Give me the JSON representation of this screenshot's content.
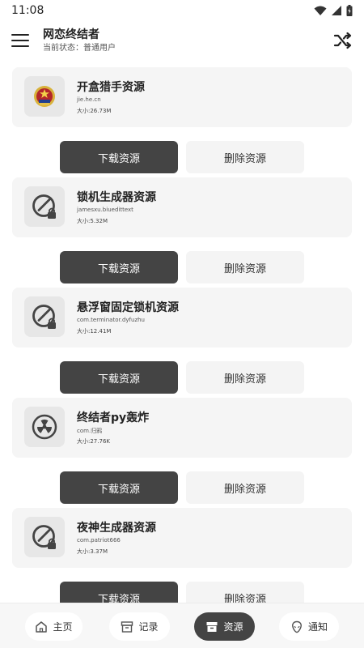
{
  "status_bar": {
    "time": "11:08"
  },
  "app_bar": {
    "title": "网恋终结者",
    "subtitle": "当前状态：普通用户"
  },
  "resources": [
    {
      "name": "开盒猎手资源",
      "package": "jie.he.cn",
      "size": "大小:26.73M",
      "icon": "police-emblem-icon"
    },
    {
      "name": "锁机生成器资源",
      "package": "jamesxu.biuedittext",
      "size": "大小:5.32M",
      "icon": "lock-ban-icon"
    },
    {
      "name": "悬浮窗固定锁机资源",
      "package": "com.terminator.dyfuzhu",
      "size": "大小:12.41M",
      "icon": "lock-ban-icon"
    },
    {
      "name": "终结者py轰炸",
      "package": "com.归鸦",
      "size": "大小:27.76K",
      "icon": "radiation-icon"
    },
    {
      "name": "夜神生成器资源",
      "package": "com.patriot666",
      "size": "大小:3.37M",
      "icon": "lock-ban-icon"
    }
  ],
  "actions": {
    "download": "下载资源",
    "delete": "删除资源"
  },
  "bottom_nav": {
    "items": [
      {
        "label": "主页",
        "icon": "home-icon",
        "active": false
      },
      {
        "label": "记录",
        "icon": "archive-icon",
        "active": false
      },
      {
        "label": "资源",
        "icon": "archive-icon",
        "active": true
      },
      {
        "label": "通知",
        "icon": "alien-icon",
        "active": false
      }
    ]
  },
  "colors": {
    "primary": "#444444",
    "card_bg": "#f5f5f5",
    "secondary_button": "#f4f4f4"
  }
}
